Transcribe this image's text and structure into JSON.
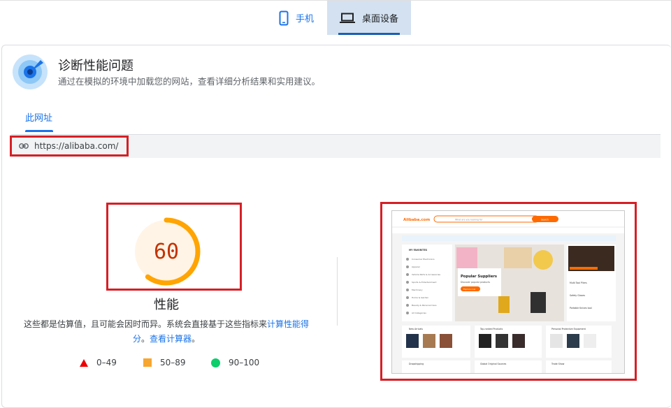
{
  "device_tabs": {
    "mobile": "手机",
    "desktop": "桌面设备"
  },
  "section": {
    "title": "诊断性能问题",
    "subtitle": "通过在模拟的环境中加载您的网站，查看详细分析结果和实用建议。"
  },
  "url_tab": "此网址",
  "url": "https://alibaba.com/",
  "score": {
    "value": "60",
    "fraction": 0.6,
    "color": "#ffa400",
    "label": "性能",
    "description": "这些都是估算值，且可能会因时而异。系统会直接基于这些指标来",
    "calc_link": "计算性能得分",
    "period": "。",
    "calculator_link": "查看计算器",
    "period2": "。"
  },
  "legend": [
    {
      "symbol": "triangle",
      "range": "0–49",
      "color": "#e00000"
    },
    {
      "symbol": "square",
      "range": "50–89",
      "color": "#f7a630"
    },
    {
      "symbol": "circle",
      "range": "90–100",
      "color": "#0cce6b"
    }
  ],
  "thumbnail": {
    "header_logo": "Alibaba.com",
    "search_placeholder": "What are you looking for",
    "search_button": "Search",
    "banner_title": "Popular Suppliers",
    "banner_subtitle": "Discover popular products",
    "banner_button": "Explore now",
    "sidebar_title": "MY FAVORITES",
    "sidebar_items": [
      "Consumer Electronics",
      "Apparel",
      "Vehicle Parts & Accessories",
      "Sports & Entertainment",
      "Machinery",
      "Home & Garden",
      "Beauty & Personal Care",
      "All Categories"
    ],
    "right_items": [
      "Multi Tool Pliers",
      "Safety Gloves",
      "Portable Knives tool"
    ],
    "sections": [
      "New Arrivals",
      "Top-ranked Products",
      "Personal Protective Equipment",
      "Dropshipping",
      "Global Original Sources",
      "Trade Show"
    ]
  }
}
